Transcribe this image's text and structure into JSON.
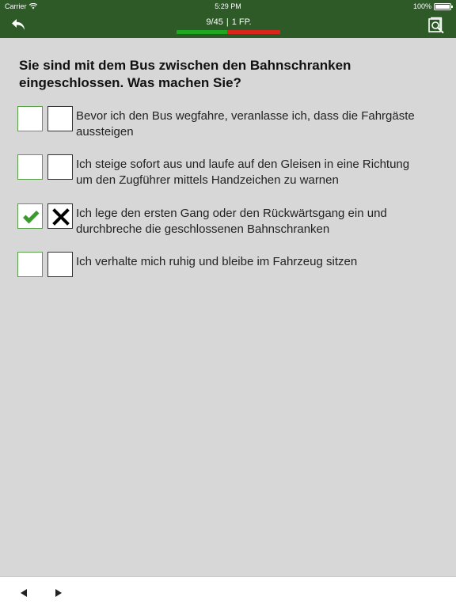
{
  "status_bar": {
    "carrier": "Carrier",
    "time": "5:29 PM",
    "battery": "100%"
  },
  "header": {
    "counter_current": "9/45",
    "separator": "|",
    "points": "1 FP.",
    "progress_fraction": 0.49,
    "colors": {
      "bar": "#2d5a27",
      "progress_good": "#1fa81f",
      "progress_bad": "#d8261d"
    }
  },
  "question": {
    "text": "Sie sind mit dem Bus zwischen den Bahnschranken eingeschlossen. Was machen Sie?"
  },
  "answers": [
    {
      "line1": "Bevor ich den Bus wegfahre, veranlasse ich, dass die Fahrgäste",
      "line2": "aussteigen",
      "user_checked": false,
      "solution_marked": false
    },
    {
      "line1": "Ich steige sofort aus und laufe auf den Gleisen in eine Richtung",
      "line2": "um den Zugführer mittels Handzeichen zu warnen",
      "user_checked": false,
      "solution_marked": false
    },
    {
      "line1": "Ich lege den ersten Gang oder den Rückwärtsgang ein und",
      "line2": "durchbreche die geschlossenen Bahnschranken",
      "user_checked": true,
      "solution_marked": true
    },
    {
      "line1": "Ich verhalte mich ruhig und bleibe im Fahrzeug sitzen",
      "line2": "",
      "user_checked": false,
      "solution_marked": false
    }
  ],
  "footer": {
    "prev_icon": "triangle-left-icon",
    "next_icon": "triangle-right-icon"
  }
}
